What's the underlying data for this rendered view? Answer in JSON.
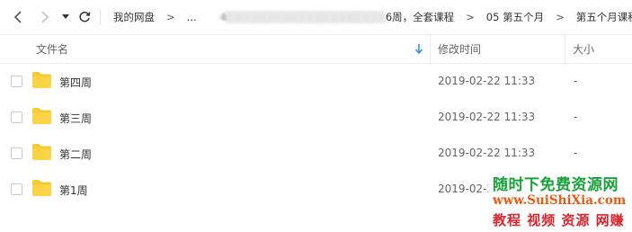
{
  "breadcrumb": {
    "items": [
      "我的网盘",
      "...",
      "4░░░░░░░░░░░░░░░░░░░░",
      "6周，全套课程",
      "05 第五个月",
      "第五个月课程"
    ],
    "separator": ">"
  },
  "columns": {
    "name": "文件名",
    "modified": "修改时间",
    "size": "大小"
  },
  "files": [
    {
      "name": "第四周",
      "modified": "2019-02-22 11:33",
      "size": "-"
    },
    {
      "name": "第三周",
      "modified": "2019-02-22 11:33",
      "size": "-"
    },
    {
      "name": "第二周",
      "modified": "2019-02-22 11:33",
      "size": "-"
    },
    {
      "name": "第1周",
      "modified": "2019-02-22 11:33",
      "size": "-"
    }
  ],
  "watermark": {
    "line1": "随时下免费资源网",
    "line2": "www.SuiShiXia.com",
    "line3": "教程 视频 资源 网赚"
  },
  "icons": {
    "back": "chevron-left-icon",
    "forward": "chevron-right-icon",
    "history": "caret-down-icon",
    "refresh": "refresh-icon",
    "sort": "arrow-down-icon",
    "folder": "folder-icon"
  },
  "colors": {
    "accent": "#2d8cf0",
    "folder": "#f7c933",
    "watermark_green": "#1aa13b",
    "watermark_orange": "#ea5a12",
    "watermark_red": "#d9262e"
  }
}
